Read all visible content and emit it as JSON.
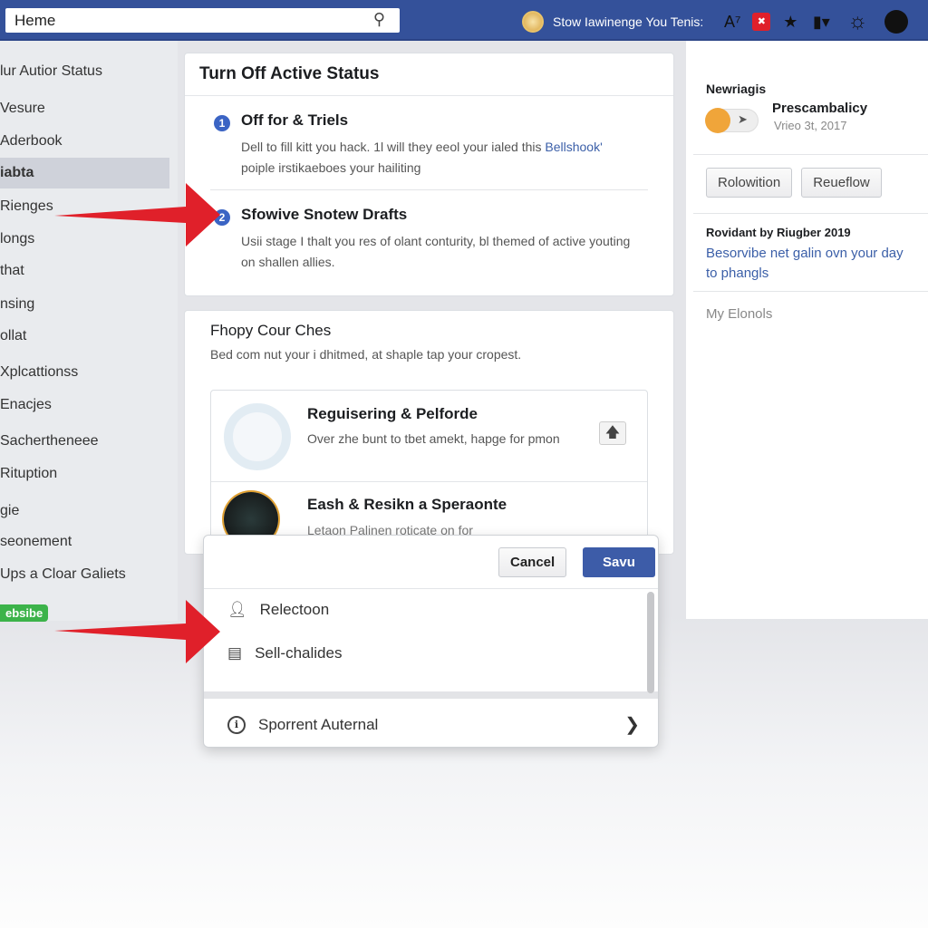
{
  "topbar": {
    "search_value": "Heme",
    "user_text": "Stow Iawinenge You Tenis:",
    "colors": {
      "bar": "#34519a"
    },
    "icons": [
      "search-icon",
      "translate-icon",
      "notification-icon",
      "star-icon",
      "bookmark-icon",
      "settings-icon",
      "profile-icon"
    ]
  },
  "sidebar": {
    "items": [
      "lur Autior Status",
      "Vesure",
      "Aderbook",
      "iabta",
      "Rienges",
      "longs",
      "that",
      "nsing",
      "ollat",
      "Xplcattionss",
      "Enacjes",
      "Sachertheneee",
      "Rituption",
      "gie",
      "seonement",
      "Ups a Cloar Galiets"
    ],
    "active_index": 3,
    "badge": "ebsibe"
  },
  "main": {
    "card1": {
      "title": "Turn Off Active Status",
      "steps": [
        {
          "num": "1",
          "title": "Off for & Triels",
          "text": "Dell to fill kitt you hack.  1l will  they eeol your ialed this ",
          "link": "Bellshook'",
          "text2": "poiple irstikaeboes your hailiting"
        },
        {
          "num": "2",
          "title": "Sfowive Snotew Drafts",
          "text": "Usii stage I thalt you res of olant conturity, bl themed of active youting on shallen allies."
        }
      ]
    },
    "card2": {
      "title": "Fhopy Cour Ches",
      "subtitle": "Bed com nut your i dhitmed, at shaple tap your cropest.",
      "items": [
        {
          "title": "Reguisering & Pelforde",
          "text": "Over zhe bunt to tbet amekt, hapge for pmon"
        },
        {
          "title": "Eash & Resikn a Speraonte",
          "text": "Letaon Palinen roticate on for"
        }
      ]
    }
  },
  "right": {
    "heading": "Newriagis",
    "name": "Prescambalicy",
    "date": "Vrieo 3t, 2017",
    "buttons": [
      "Rolowition",
      "Reueflow"
    ],
    "provided": "Rovidant by Riugber 2019",
    "link": "Besorvibe net galin ovn your day to phangls",
    "footer": "My Elonols"
  },
  "popup": {
    "cancel": "Cancel",
    "save": "Savu",
    "items": [
      "Relectoon",
      "Sell-chalides"
    ],
    "footer_item": "Sporrent Auternal"
  },
  "colors": {
    "accent": "#3b5fa8",
    "arrow": "#e0202a",
    "save": "#3d5ca8"
  }
}
